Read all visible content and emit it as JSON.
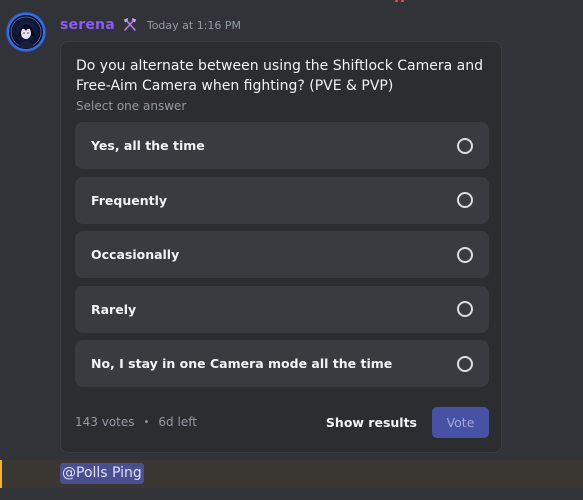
{
  "message": {
    "username": "serena",
    "username_color": "#8a5cf5",
    "role_icon": "crossed-axes-icon",
    "timestamp": "Today at 1:16 PM",
    "avatar": "anime-character-avatar"
  },
  "poll": {
    "question": "Do you alternate between using the Shiftlock Camera and Free-Aim Camera when fighting? (PVE & PVP)",
    "hint": "Select one answer",
    "answers": [
      {
        "label": "Yes, all the time"
      },
      {
        "label": "Frequently"
      },
      {
        "label": "Occasionally"
      },
      {
        "label": "Rarely"
      },
      {
        "label": "No, I stay in one Camera mode all the time"
      }
    ],
    "votes": "143 votes",
    "separator": "•",
    "time_left": "6d left",
    "show_results_label": "Show results",
    "vote_label": "Vote",
    "vote_color": "#4752a5"
  },
  "mention": {
    "label": "@Polls Ping",
    "color": "#4c4f8f"
  }
}
